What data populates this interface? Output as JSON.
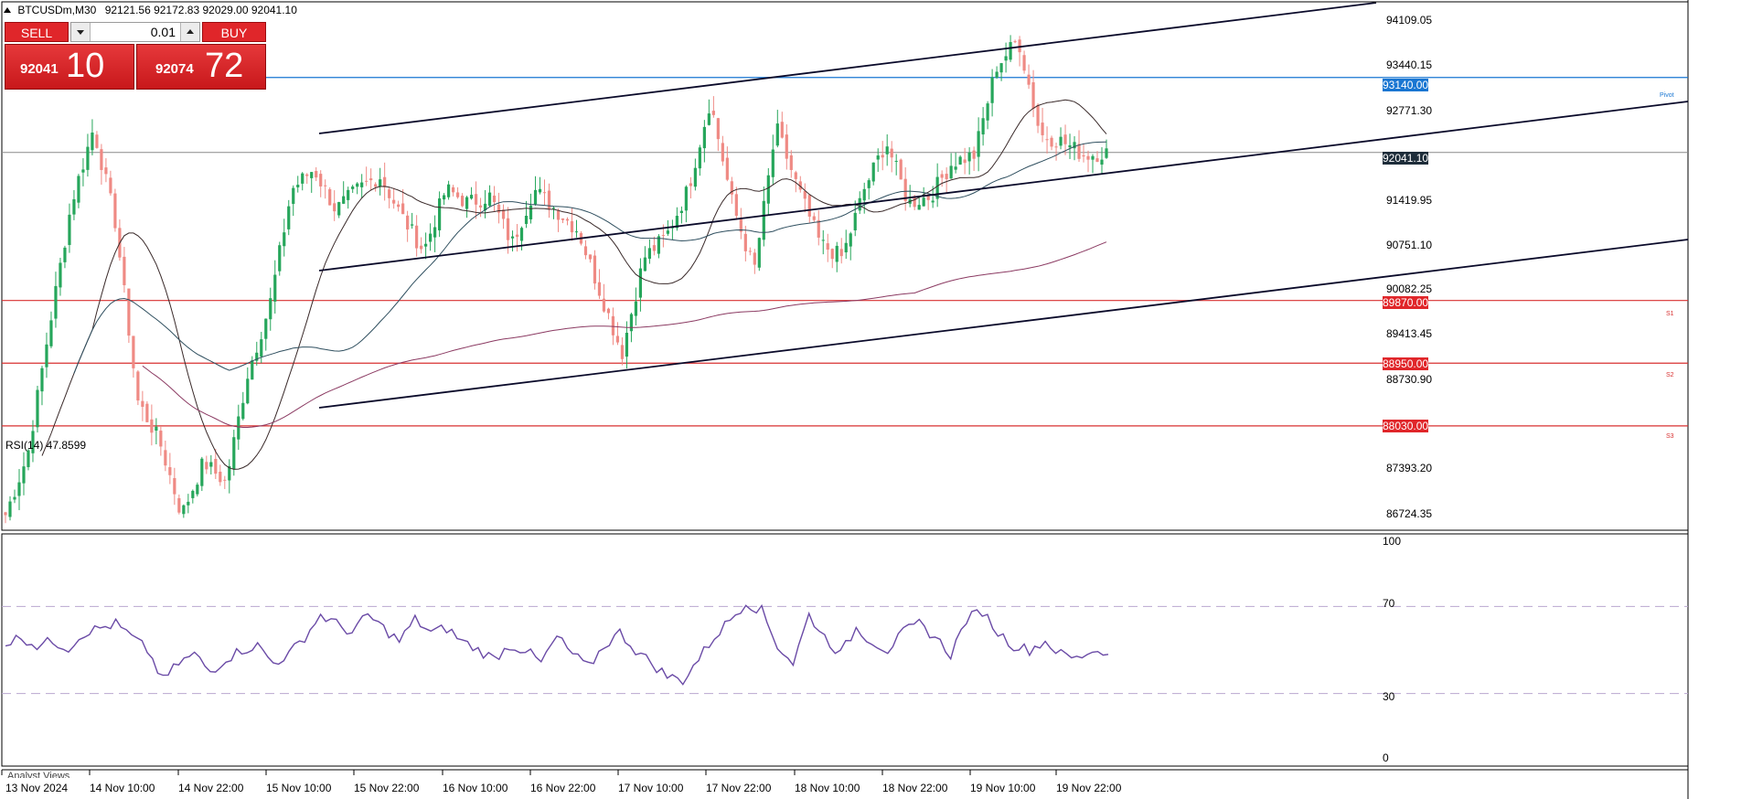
{
  "header": {
    "symbol": "BTCUSDm,M30",
    "ohlc": "92121.56 92172.83 92029.00 92041.10"
  },
  "trade_panel": {
    "sell_label": "SELL",
    "buy_label": "BUY",
    "lot_value": "0.01",
    "sell_price_small": "92041",
    "sell_price_big": "10",
    "buy_price_small": "92074",
    "buy_price_big": "72"
  },
  "price_axis": {
    "ticks": [
      "94109.05",
      "93440.15",
      "92771.30",
      "91419.95",
      "90751.10",
      "90082.25",
      "89413.45",
      "88730.90",
      "87393.20",
      "86724.35"
    ],
    "levels": {
      "pivot": {
        "value": "93140.00",
        "note": "Pivot"
      },
      "current": {
        "value": "92041.10"
      },
      "s1": {
        "value": "89870.00",
        "note": "S1"
      },
      "s2": {
        "value": "88950.00",
        "note": "S2"
      },
      "s3": {
        "value": "88030.00",
        "note": "S3"
      }
    }
  },
  "time_axis": {
    "labels": [
      "13 Nov 2024",
      "14 Nov 10:00",
      "14 Nov 22:00",
      "15 Nov 10:00",
      "15 Nov 22:00",
      "16 Nov 10:00",
      "16 Nov 22:00",
      "17 Nov 10:00",
      "17 Nov 22:00",
      "18 Nov 10:00",
      "18 Nov 22:00",
      "19 Nov 10:00",
      "19 Nov 22:00"
    ]
  },
  "rsi": {
    "title": "RSI(14) 47.8599",
    "ticks": [
      "100",
      "70",
      "30",
      "0"
    ]
  },
  "analyst_views": "Analyst Views",
  "colors": {
    "bull": "#26a65b",
    "bear": "#ef8a84",
    "rsi_line": "#6a4aa6",
    "support": "#d83030",
    "pivot": "#1976d2"
  },
  "chart_data": {
    "type": "candlestick",
    "timeframe": "M30",
    "ylim": [
      86500,
      94250
    ],
    "key_prices": [
      [
        86724,
        87600,
        89500,
        91300,
        92400,
        91000,
        88400,
        87800,
        86724,
        87500,
        87200,
        88800,
        89800,
        91500,
        91800,
        91200,
        91500,
        91700,
        91100,
        90600,
        91500,
        91300,
        91400,
        90700,
        91500,
        91200,
        90900,
        90000,
        89100,
        90500,
        90800,
        91500,
        92800,
        91300,
        90300,
        92400,
        91500,
        90700,
        90500,
        91500,
        92200,
        91300,
        91400,
        91900,
        92000,
        93300,
        93700,
        92300,
        92200,
        92000,
        92041
      ]
    ],
    "rsi_values": [
      53,
      56,
      52,
      54,
      51,
      58,
      60,
      62,
      56,
      50,
      36,
      44,
      48,
      40,
      46,
      50,
      52,
      44,
      48,
      56,
      66,
      62,
      58,
      66,
      60,
      54,
      64,
      58,
      60,
      54,
      50,
      46,
      52,
      50,
      44,
      56,
      48,
      42,
      52,
      58,
      50,
      44,
      38,
      36,
      46,
      56,
      64,
      72,
      68,
      52,
      44,
      66,
      56,
      48,
      60,
      54,
      50,
      58,
      62,
      56,
      48,
      64,
      68,
      58,
      52,
      50,
      54,
      48,
      46,
      50,
      48
    ]
  }
}
